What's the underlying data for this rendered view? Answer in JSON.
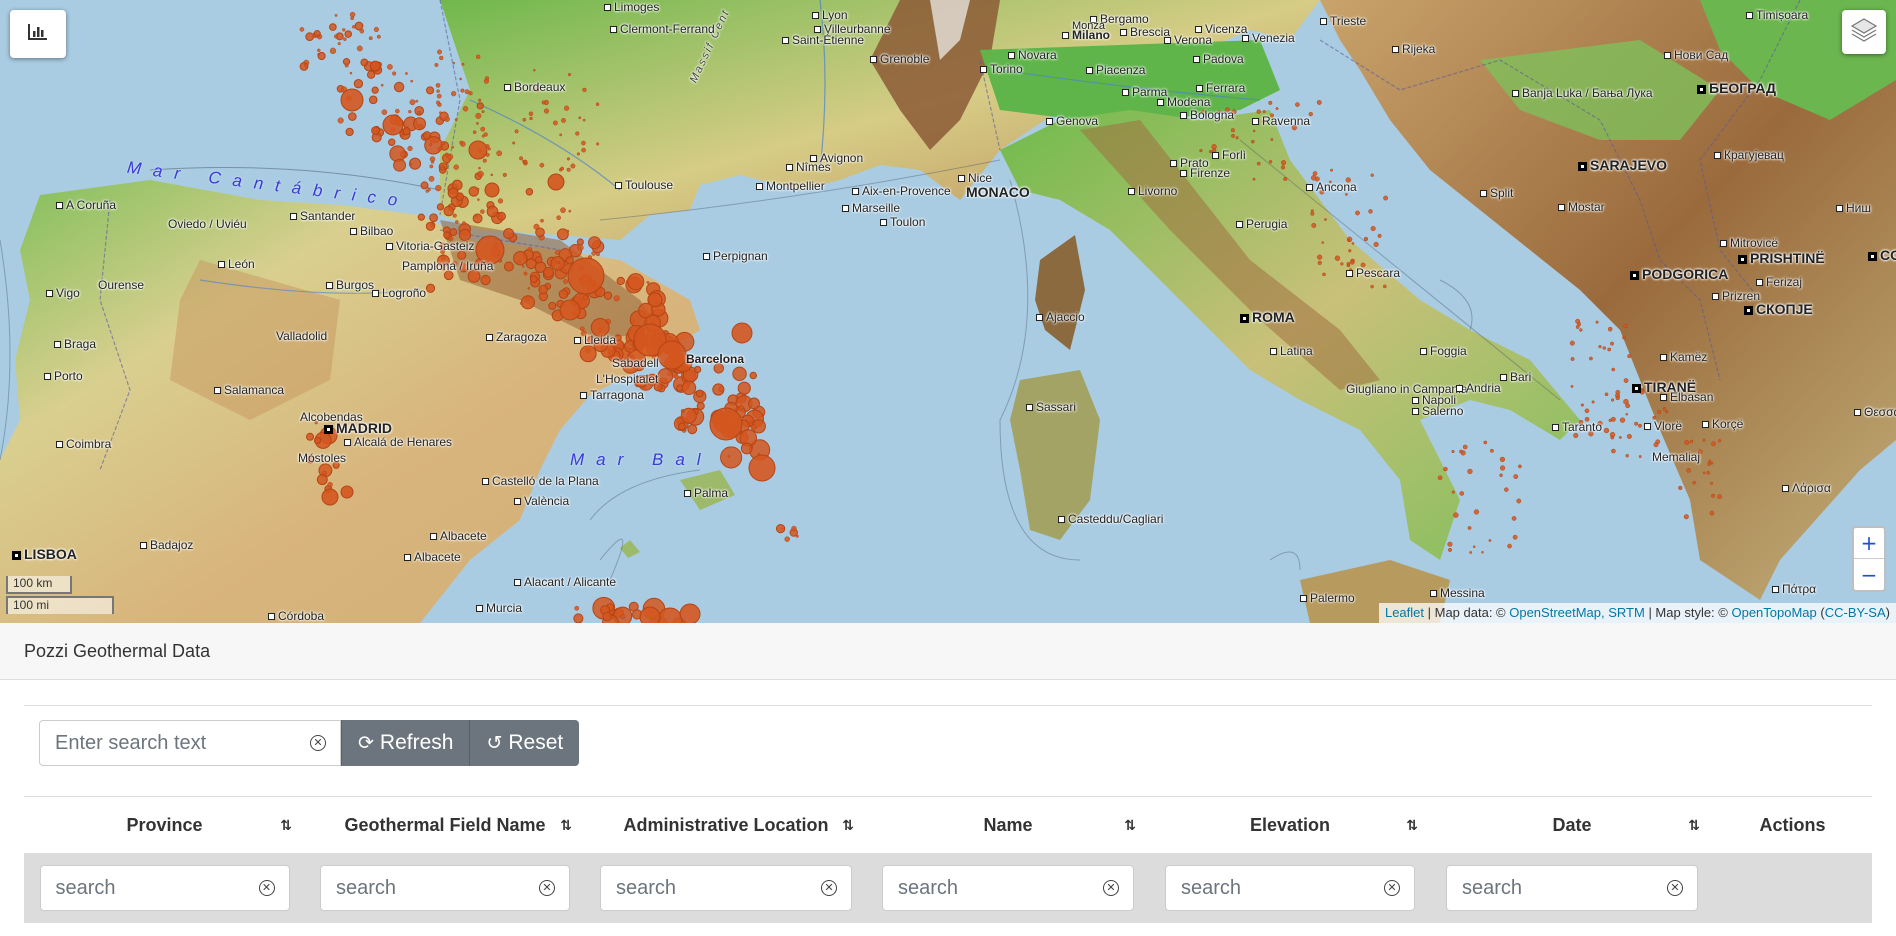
{
  "map": {
    "chart_button_icon": "bar-chart-icon",
    "layers_button_icon": "layers-icon",
    "zoom_in": "+",
    "zoom_out": "−",
    "scale_km": "100 km",
    "scale_mi": "100 mi",
    "attribution": {
      "leaflet": "Leaflet",
      "sep1": " | Map data: © ",
      "osm": "OpenStreetMap, SRTM",
      "sep2": " | Map style: © ",
      "otm": "OpenTopoMap",
      "open": " (",
      "license": "CC-BY-SA",
      "close": ")"
    },
    "colors": {
      "sea": "#a9cce3",
      "marker": "#d4561f",
      "marker_stroke": "#b44515"
    },
    "labels": {
      "lisboa": "LISBOA",
      "madrid": "MADRID",
      "roma": "ROMA",
      "monaco": "MONACO",
      "sarajevo": "SARAJEVO",
      "beograd": "БЕОГРАД",
      "podgorica": "PODGORICA",
      "tirane": "TIRANË",
      "prishtine": "PRISHTINË",
      "skopje": "СКОПЈЕ",
      "mar_cantabrico": "Mar Cantábrico",
      "mar_bal": "Mar Bal",
      "massif": "Massif Cent",
      "bordeaux": "Bordeaux",
      "toulouse": "Toulouse",
      "limoges": "Limoges",
      "clermont": "Clermont-Ferrand",
      "lyon": "Lyon",
      "villeurbanne": "Villeurbanne",
      "saint_etienne": "Saint-Étienne",
      "grenoble": "Grenoble",
      "nimes": "Nîmes",
      "avignon": "Avignon",
      "montpellier": "Montpellier",
      "aix": "Aix-en-Provence",
      "marseille": "Marseille",
      "toulon": "Toulon",
      "nice": "Nice",
      "perpignan": "Perpignan",
      "torino": "Torino",
      "milano": "Milano",
      "bergamo": "Bergamo",
      "monza": "Monza",
      "brescia": "Brescia",
      "verona": "Verona",
      "vicenza": "Vicenza",
      "padova": "Padova",
      "venezia": "Venezia",
      "trieste": "Trieste",
      "novara": "Novara",
      "piacenza": "Piacenza",
      "parma": "Parma",
      "modena": "Modena",
      "bologna": "Bologna",
      "ferrara": "Ferrara",
      "genova": "Genova",
      "ravenna": "Ravenna",
      "forli": "Forlì",
      "prato": "Prato",
      "firenze": "Firenze",
      "livorno": "Livorno",
      "perugia": "Perugia",
      "ancona": "Ancona",
      "pescara": "Pescara",
      "latina": "Latina",
      "foggia": "Foggia",
      "bari": "Bari",
      "napoli": "Napoli",
      "giugliano": "Giugliano in Campania",
      "salerno": "Salerno",
      "andria": "Andria",
      "taranto": "Taranto",
      "ajaccio": "Ajaccio",
      "sassari": "Sassari",
      "cagliari": "Casteddu/Cagliari",
      "palermo": "Palermo",
      "messina": "Messina",
      "rijeka": "Rijeka",
      "split": "Split",
      "mostar": "Mostar",
      "banja_luka": "Banja Luka / Бања Лука",
      "novi_sad": "Нови Сад",
      "timisoara": "Timișoara",
      "kragujevac": "Крагујевац",
      "nis": "Ниш",
      "mitrovice": "Mitrovicë",
      "ferizaj": "Ferizaj",
      "prizren": "Prizren",
      "kamez": "Kamëz",
      "elbasan": "Elbasan",
      "vlore": "Vlorë",
      "korce": "Korçë",
      "memaliaj": "Memaliaj",
      "larisa": "Λάρισα",
      "patra": "Πάτρα",
      "thessaloniki": "Θεσσαλο",
      "co": "CO",
      "a_coruna": "A Coruña",
      "oviedo": "Oviedo / Uviéu",
      "santander": "Santander",
      "bilbao": "Bilbao",
      "vitoria": "Vitoria-Gasteiz",
      "pamplona": "Pamplona / Iruña",
      "leon": "León",
      "burgos": "Burgos",
      "logrono": "Logroño",
      "vigo": "Vigo",
      "ourense": "Ourense",
      "valladolid": "Valladolid",
      "braga": "Braga",
      "porto": "Porto",
      "salamanca": "Salamanca",
      "zaragoza": "Zaragoza",
      "lleida": "Lleida",
      "sabadell": "Sabadell",
      "hospitalet": "L'Hospitalet",
      "tarragona": "Tarragona",
      "barcelona": "Barcelona",
      "alcobendas": "Alcobendas",
      "alcala": "Alcalá de Henares",
      "mostoles": "Móstoles",
      "coimbra": "Coimbra",
      "castello": "Castelló de la Plana",
      "valencia": "València",
      "palma": "Palma",
      "albacete": "Albacete",
      "badajoz": "Badajoz",
      "alacant": "Alacant / Alicante",
      "murcia": "Murcia",
      "cordoba": "Córdoba"
    }
  },
  "panel": {
    "title": "Pozzi Geothermal Data",
    "search_placeholder": "Enter search text",
    "refresh_label": "Refresh",
    "reset_label": "Reset",
    "columns": [
      {
        "label": "Province",
        "sortable": true
      },
      {
        "label": "Geothermal Field Name",
        "sortable": true
      },
      {
        "label": "Administrative Location",
        "sortable": true
      },
      {
        "label": "Name",
        "sortable": true
      },
      {
        "label": "Elevation",
        "sortable": true
      },
      {
        "label": "Date",
        "sortable": true
      },
      {
        "label": "Actions",
        "sortable": false
      }
    ],
    "filter_placeholder": "search",
    "sort_icon": "⇅"
  }
}
